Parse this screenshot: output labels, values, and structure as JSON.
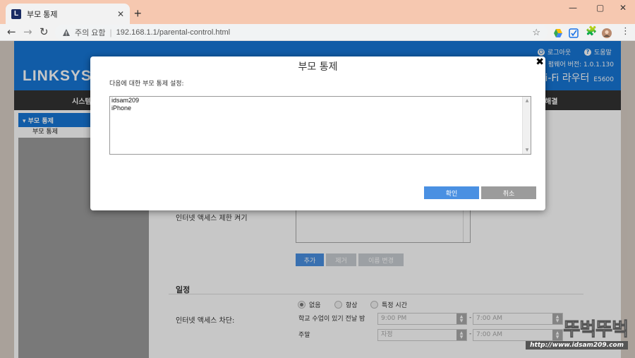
{
  "browser": {
    "tab_title": "부모 통제",
    "favicon_letter": "L",
    "new_tab": "+",
    "security_warning": "주의 요함",
    "url": "192.168.1.1/parental-control.html"
  },
  "router": {
    "logo": "LINKSYS",
    "logout": "로그아웃",
    "help": "도움말",
    "firmware": "펌웨어 버전: 1.0.1.130",
    "product_name": "i-Fi 라우터",
    "product_model": "E5600",
    "nav_items": [
      "시스템",
      "해결"
    ],
    "side_header": "▾ 부모 통제",
    "side_item": "부모 통제"
  },
  "content": {
    "internet_access_label": "인터넷 액세스 제한 켜기",
    "buttons": [
      "추가",
      "제거",
      "이름 변경"
    ],
    "schedule_title": "일정",
    "block_label": "인터넷 액세스 차단:",
    "radio_options": [
      "없음",
      "항상",
      "특정 시간"
    ],
    "school_night_label": "학교 수업이 있기 전날 밤",
    "weekend_label": "주말",
    "time_start": "9:00 PM",
    "time_end": "7:00 AM",
    "weekend_start": "자정",
    "weekend_end": "7:00 AM",
    "dash": "-"
  },
  "modal": {
    "title": "부모 통제",
    "description": "다음에 대한 부모 통제 설정:",
    "devices": [
      "idsam209",
      "iPhone"
    ],
    "ok_label": "확인",
    "cancel_label": "취소"
  },
  "watermark": {
    "big": "뚜벅뚜벅",
    "url": "http://www.idsam209.com"
  },
  "colors": {
    "linksys_blue": "#1676d6",
    "ok_button": "#4a90e2",
    "cancel_button": "#9b9b9b",
    "tabbar": "#f6c8b0"
  }
}
